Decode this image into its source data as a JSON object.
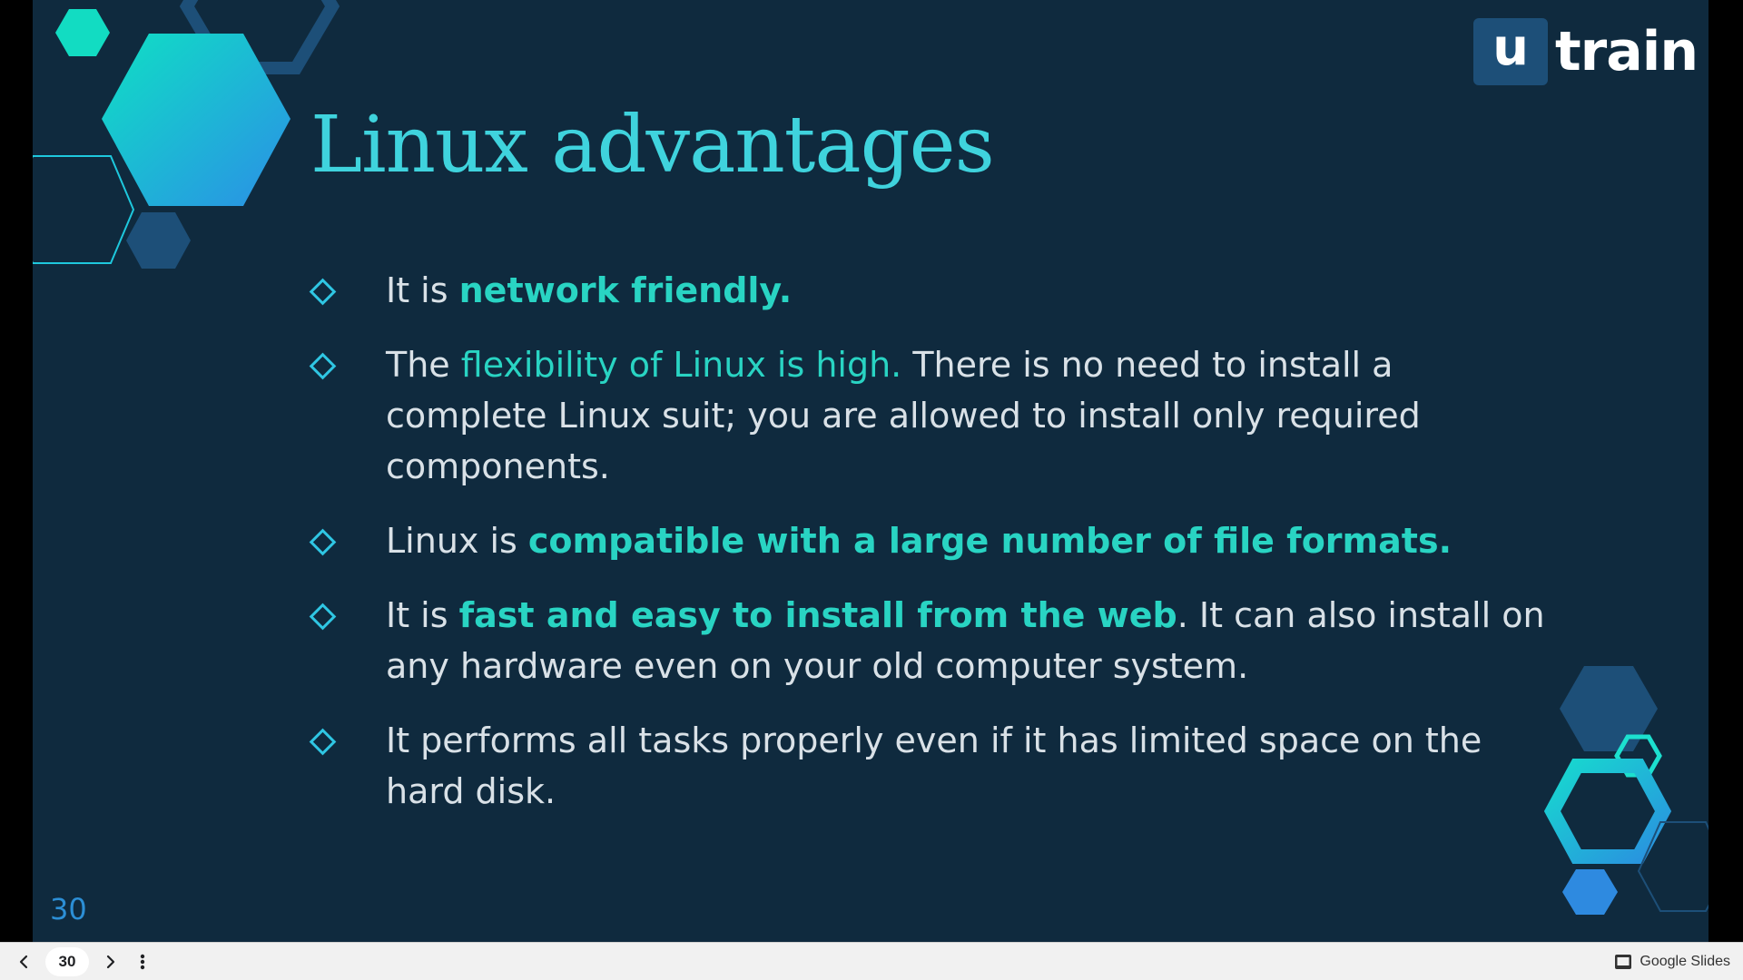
{
  "logo": {
    "mark": "u",
    "word": "train"
  },
  "slide": {
    "title": "Linux advantages",
    "number": "30",
    "bullets": [
      {
        "segments": [
          {
            "text": "It is ",
            "style": "plain"
          },
          {
            "text": "network friendly.",
            "style": "highlight-bold"
          }
        ]
      },
      {
        "segments": [
          {
            "text": "The ",
            "style": "plain"
          },
          {
            "text": "flexibility of Linux is high.",
            "style": "highlight"
          },
          {
            "text": " There is no need to install a complete Linux suit; you are allowed to install only required components.",
            "style": "plain"
          }
        ]
      },
      {
        "segments": [
          {
            "text": "Linux is ",
            "style": "plain"
          },
          {
            "text": "compatible with a large number of file formats.",
            "style": "highlight-bold"
          }
        ]
      },
      {
        "segments": [
          {
            "text": "It is ",
            "style": "plain"
          },
          {
            "text": "fast and easy to install from the web",
            "style": "highlight-bold"
          },
          {
            "text": ". It can also install on any hardware even on your old computer system.",
            "style": "plain"
          }
        ]
      },
      {
        "segments": [
          {
            "text": "It performs all tasks properly even if it has limited space on the hard disk.",
            "style": "plain"
          }
        ]
      }
    ]
  },
  "viewer": {
    "page_number": "30",
    "brand": "Google Slides",
    "prev_icon": "chevron-left-icon",
    "next_icon": "chevron-right-icon",
    "more_icon": "more-vertical-icon",
    "brand_icon": "slides-icon"
  },
  "colors": {
    "slide_bg": "#0f2a3e",
    "title": "#3fd3dd",
    "body_text": "#d9e1e7",
    "highlight": "#29d4c3",
    "bullet_diamond": "#2fc6e3",
    "hex_dark": "#1d4f78",
    "hex_teal": "#12d6c2",
    "hex_blue": "#2e8ae0"
  }
}
